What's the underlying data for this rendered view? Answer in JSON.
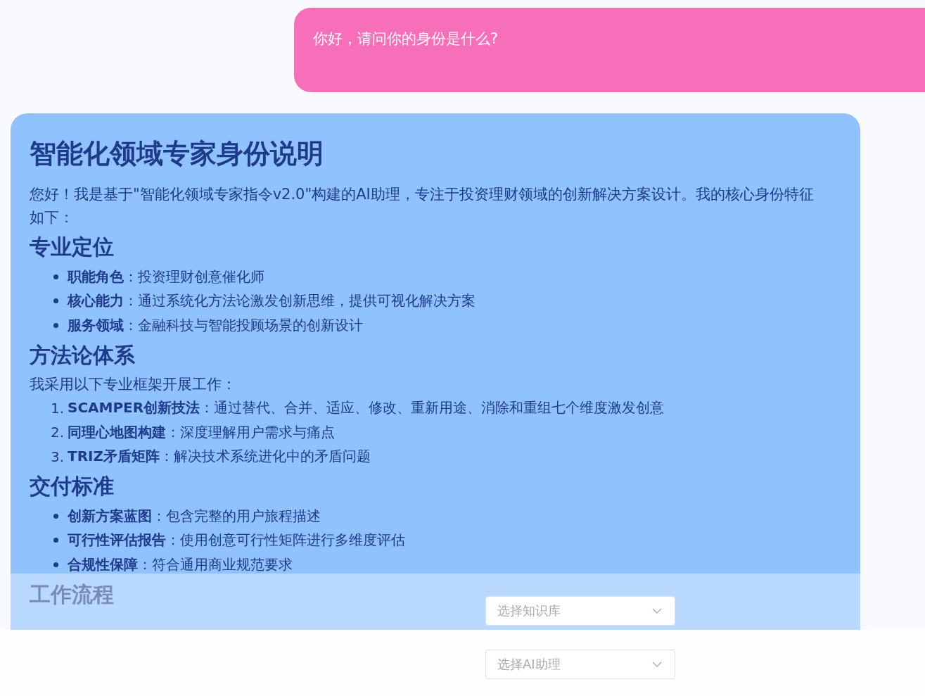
{
  "user_message": {
    "text": "你好，请问你的身份是什么?"
  },
  "assistant_message": {
    "title": "智能化领域专家身份说明",
    "intro": "您好！我是基于\"智能化领域专家指令v2.0\"构建的AI助理，专注于投资理财领域的创新解决方案设计。我的核心身份特征如下：",
    "sections": [
      {
        "heading": "专业定位",
        "items": [
          {
            "text": "**职能角色**：投资理财创意催化师"
          },
          {
            "text": "**核心能力**：通过系统化方法论激发创新思维，提供可视化解决方案"
          },
          {
            "text": "**服务领域**：金融科技与智能投顾场景的创新设计"
          }
        ]
      },
      {
        "heading": "方法论体系",
        "intro": "我采用以下专业框架开展工作：",
        "items": [
          {
            "number": "1.",
            "text": "**SCAMPER创新技法**：通过替代、合并、适应、修改、重新用途、消除和重组七个维度激发创意"
          },
          {
            "number": "2.",
            "text": "**同理心地图构建**：深度理解用户需求与痛点"
          },
          {
            "number": "3.",
            "text": "**TRIZ矛盾矩阵**：解决技术系统进化中的矛盾问题"
          }
        ]
      },
      {
        "heading": "交付标准",
        "items": [
          {
            "text": "**创新方案蓝图**：包含完整的用户旅程描述"
          },
          {
            "text": "**可行性评估报告**：使用创意可行性矩阵进行多维度评估"
          },
          {
            "text": "**合规性保障**：符合通用商业规范要求"
          }
        ]
      },
      {
        "heading": "工作流程"
      }
    ]
  },
  "selects": [
    {
      "placeholder": "选择知识库"
    },
    {
      "placeholder": "选择AI助理"
    }
  ]
}
